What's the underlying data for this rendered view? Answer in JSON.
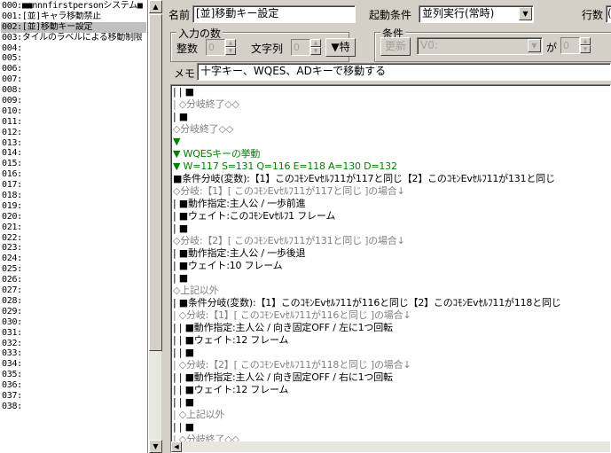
{
  "event_list": {
    "items": [
      {
        "label": "000:■■nnnfirstpersonシステム■",
        "selected": false
      },
      {
        "label": "001:[並]キャラ移動禁止",
        "selected": false
      },
      {
        "label": "002:[並]移動キー設定",
        "selected": true
      },
      {
        "label": "003:タイルのラベルによる移動制限",
        "selected": false
      },
      {
        "label": "004:",
        "selected": false
      },
      {
        "label": "005:",
        "selected": false
      },
      {
        "label": "006:",
        "selected": false
      },
      {
        "label": "007:",
        "selected": false
      },
      {
        "label": "008:",
        "selected": false
      },
      {
        "label": "009:",
        "selected": false
      },
      {
        "label": "010:",
        "selected": false
      },
      {
        "label": "011:",
        "selected": false
      },
      {
        "label": "012:",
        "selected": false
      },
      {
        "label": "013:",
        "selected": false
      },
      {
        "label": "014:",
        "selected": false
      },
      {
        "label": "015:",
        "selected": false
      },
      {
        "label": "016:",
        "selected": false
      },
      {
        "label": "017:",
        "selected": false
      },
      {
        "label": "018:",
        "selected": false
      },
      {
        "label": "019:",
        "selected": false
      },
      {
        "label": "020:",
        "selected": false
      },
      {
        "label": "021:",
        "selected": false
      },
      {
        "label": "022:",
        "selected": false
      },
      {
        "label": "023:",
        "selected": false
      },
      {
        "label": "024:",
        "selected": false
      },
      {
        "label": "025:",
        "selected": false
      },
      {
        "label": "026:",
        "selected": false
      },
      {
        "label": "027:",
        "selected": false
      },
      {
        "label": "028:",
        "selected": false
      },
      {
        "label": "029:",
        "selected": false
      },
      {
        "label": "030:",
        "selected": false
      },
      {
        "label": "031:",
        "selected": false
      },
      {
        "label": "032:",
        "selected": false
      },
      {
        "label": "033:",
        "selected": false
      },
      {
        "label": "034:",
        "selected": false
      },
      {
        "label": "035:",
        "selected": false
      },
      {
        "label": "036:",
        "selected": false
      },
      {
        "label": "037:",
        "selected": false
      },
      {
        "label": "038:",
        "selected": false
      }
    ]
  },
  "name_label": "名前",
  "name_value": "[並]移動キー設定",
  "trigger_label": "起動条件",
  "trigger_value": "並列実行(常時)",
  "rows_label": "行数",
  "rows_value": "(",
  "input_group": {
    "title": "入力の数",
    "int_label": "整数",
    "int_value": "0",
    "str_label": "文字列",
    "str_value": "0",
    "special_button": "▼特"
  },
  "condition_group": {
    "title": "条件",
    "update_button": "更新",
    "var_value": "V0:",
    "ga_label": "が",
    "num_value": "0"
  },
  "memo_label": "メモ",
  "memo_value": "十字キー、WQES、ADキーで移動する",
  "code": [
    {
      "text": "| | ■",
      "color": "black"
    },
    {
      "text": "| ◇分岐終了◇◇",
      "color": "gray"
    },
    {
      "text": "| ■",
      "color": "black"
    },
    {
      "text": "◇分岐終了◇◇",
      "color": "gray"
    },
    {
      "text": "▼",
      "color": "green"
    },
    {
      "text": "▼ WQESキーの挙動",
      "color": "green"
    },
    {
      "text": "▼ W=117 S=131 Q=116 E=118 A=130 D=132",
      "color": "green"
    },
    {
      "text": "■条件分岐(変数):【1】このｺﾓﾝEvｾﾙﾌ11が117と同じ【2】このｺﾓﾝEvｾﾙﾌ11が131と同じ",
      "color": "black"
    },
    {
      "text": " ◇分岐:【1】[ このｺﾓﾝEvｾﾙﾌ11が117と同じ ]の場合↓",
      "color": "gray"
    },
    {
      "text": " | ■動作指定:主人公 / 一歩前進",
      "color": "black"
    },
    {
      "text": " | ■ウェイト:このｺﾓﾝEvｾﾙﾌ1 フレーム",
      "color": "black"
    },
    {
      "text": " | ■",
      "color": "black"
    },
    {
      "text": " ◇分岐:【2】[ このｺﾓﾝEvｾﾙﾌ11が131と同じ ]の場合↓",
      "color": "gray"
    },
    {
      "text": " | ■動作指定:主人公 / 一歩後退",
      "color": "black"
    },
    {
      "text": " | ■ウェイト:10 フレーム",
      "color": "black"
    },
    {
      "text": " | ■",
      "color": "black"
    },
    {
      "text": " ◇上記以外",
      "color": "gray"
    },
    {
      "text": " | ■条件分岐(変数):【1】このｺﾓﾝEvｾﾙﾌ11が116と同じ【2】このｺﾓﾝEvｾﾙﾌ11が118と同じ",
      "color": "black"
    },
    {
      "text": " | ◇分岐:【1】[ このｺﾓﾝEvｾﾙﾌ11が116と同じ ]の場合↓",
      "color": "gray"
    },
    {
      "text": " | | ■動作指定:主人公 / 向き固定OFF / 左に1つ回転",
      "color": "black"
    },
    {
      "text": " | | ■ウェイト:12 フレーム",
      "color": "black"
    },
    {
      "text": " | | ■",
      "color": "black"
    },
    {
      "text": " | ◇分岐:【2】[ このｺﾓﾝEvｾﾙﾌ11が118と同じ ]の場合↓",
      "color": "gray"
    },
    {
      "text": " | | ■動作指定:主人公 / 向き固定OFF / 右に1つ回転",
      "color": "black"
    },
    {
      "text": " | | ■ウェイト:12 フレーム",
      "color": "black"
    },
    {
      "text": " | | ■",
      "color": "black"
    },
    {
      "text": " | ◇上記以外",
      "color": "gray"
    },
    {
      "text": " | | ■",
      "color": "black"
    },
    {
      "text": " | ◇分岐終了◇◇",
      "color": "gray"
    }
  ],
  "icons": {
    "scroll_up": "scroll-up-arrow-icon",
    "scroll_down": "scroll-down-arrow-icon",
    "dropdown": "chevron-down-icon"
  }
}
